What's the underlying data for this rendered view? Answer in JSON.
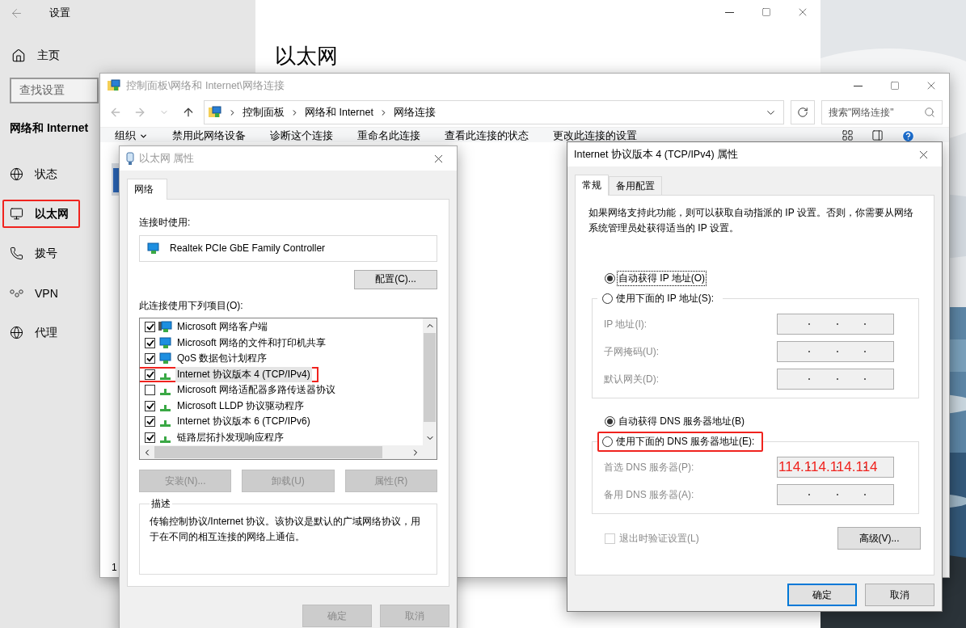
{
  "settings_window": {
    "title": "设置",
    "home": "主页",
    "search": {
      "placeholder": "查找设置"
    },
    "section": "网络和 Internet",
    "nav": [
      {
        "label": "状态",
        "kind": "status",
        "selected": false,
        "highlighted": false
      },
      {
        "label": "以太网",
        "kind": "ethernet",
        "selected": true,
        "highlighted": true
      },
      {
        "label": "拨号",
        "kind": "dialup",
        "selected": false,
        "highlighted": false
      },
      {
        "label": "VPN",
        "kind": "vpn",
        "selected": false,
        "highlighted": false
      },
      {
        "label": "代理",
        "kind": "proxy",
        "selected": false,
        "highlighted": false
      }
    ],
    "page_title": "以太网"
  },
  "explorer_window": {
    "title": "控制面板\\网络和 Internet\\网络连接",
    "active": false,
    "breadcrumb": [
      "控制面板",
      "网络和 Internet",
      "网络连接"
    ],
    "search": {
      "placeholder": "搜索\"网络连接\""
    },
    "toolbar": [
      {
        "label": "组织",
        "menu": true
      },
      {
        "label": "禁用此网络设备",
        "menu": false
      },
      {
        "label": "诊断这个连接",
        "menu": false
      },
      {
        "label": "重命名此连接",
        "menu": false
      },
      {
        "label": "查看此连接的状态",
        "menu": false
      },
      {
        "label": "更改此连接的设置",
        "menu": false
      }
    ],
    "status_bar": "1"
  },
  "ethernet_dialog": {
    "title": "以太网 属性",
    "active": false,
    "tabs": [
      {
        "label": "网络",
        "selected": true
      }
    ],
    "connect_using_label": "连接时使用:",
    "adapter": "Realtek PCIe GbE Family Controller",
    "configure_button": "配置(C)...",
    "items_label": "此连接使用下列项目(O):",
    "items": [
      {
        "label": "Microsoft 网络客户端",
        "kind": "client",
        "checked": true,
        "selected": false,
        "highlighted": false
      },
      {
        "label": "Microsoft 网络的文件和打印机共享",
        "kind": "service",
        "checked": true,
        "selected": false,
        "highlighted": false
      },
      {
        "label": "QoS 数据包计划程序",
        "kind": "service",
        "checked": true,
        "selected": false,
        "highlighted": false
      },
      {
        "label": "Internet 协议版本 4 (TCP/IPv4)",
        "kind": "protocol",
        "checked": true,
        "selected": true,
        "highlighted": true
      },
      {
        "label": "Microsoft 网络适配器多路传送器协议",
        "kind": "protocol",
        "checked": false,
        "selected": false,
        "highlighted": false
      },
      {
        "label": "Microsoft LLDP 协议驱动程序",
        "kind": "protocol",
        "checked": true,
        "selected": false,
        "highlighted": false
      },
      {
        "label": "Internet 协议版本 6 (TCP/IPv6)",
        "kind": "protocol",
        "checked": true,
        "selected": false,
        "highlighted": false
      },
      {
        "label": "链路层拓扑发现响应程序",
        "kind": "protocol",
        "checked": true,
        "selected": false,
        "highlighted": false
      }
    ],
    "item_buttons": [
      {
        "label": "安装(N)...",
        "disabled": true
      },
      {
        "label": "卸载(U)",
        "disabled": true
      },
      {
        "label": "属性(R)",
        "disabled": true
      }
    ],
    "description": {
      "title": "描述",
      "text": "传输控制协议/Internet 协议。该协议是默认的广域网络协议，用于在不同的相互连接的网络上通信。"
    },
    "buttons": [
      {
        "label": "确定",
        "disabled": true
      },
      {
        "label": "取消",
        "disabled": true
      }
    ]
  },
  "ipv4_dialog": {
    "title": "Internet 协议版本 4 (TCP/IPv4) 属性",
    "active": true,
    "tabs": [
      {
        "label": "常规",
        "selected": true
      },
      {
        "label": "备用配置",
        "selected": false
      }
    ],
    "intro": "如果网络支持此功能，则可以获取自动指派的 IP 设置。否则，你需要从网络系统管理员处获得适当的 IP 设置。",
    "ip_mode": [
      {
        "label": "自动获得 IP 地址(O)",
        "selected": true,
        "focused": true,
        "highlighted": false
      },
      {
        "label": "使用下面的 IP 地址(S):",
        "selected": false,
        "focused": false,
        "highlighted": false
      }
    ],
    "ip_fields": [
      {
        "label": "IP 地址(I):",
        "disabled": true
      },
      {
        "label": "子网掩码(U):",
        "disabled": true
      },
      {
        "label": "默认网关(D):",
        "disabled": true
      }
    ],
    "dns_mode": [
      {
        "label": "自动获得 DNS 服务器地址(B)",
        "selected": true,
        "focused": false,
        "highlighted": false
      },
      {
        "label": "使用下面的 DNS 服务器地址(E):",
        "selected": false,
        "focused": false,
        "highlighted": true
      }
    ],
    "dns_fields": [
      {
        "label": "首选 DNS 服务器(P):",
        "disabled": true,
        "value": "114.114.114.114"
      },
      {
        "label": "备用 DNS 服务器(A):",
        "disabled": true
      }
    ],
    "validate": {
      "label": "退出时验证设置(L)",
      "checked": false,
      "disabled": true
    },
    "advanced_button": "高级(V)...",
    "buttons": [
      {
        "label": "确定",
        "default": true
      },
      {
        "label": "取消",
        "default": false
      }
    ]
  }
}
